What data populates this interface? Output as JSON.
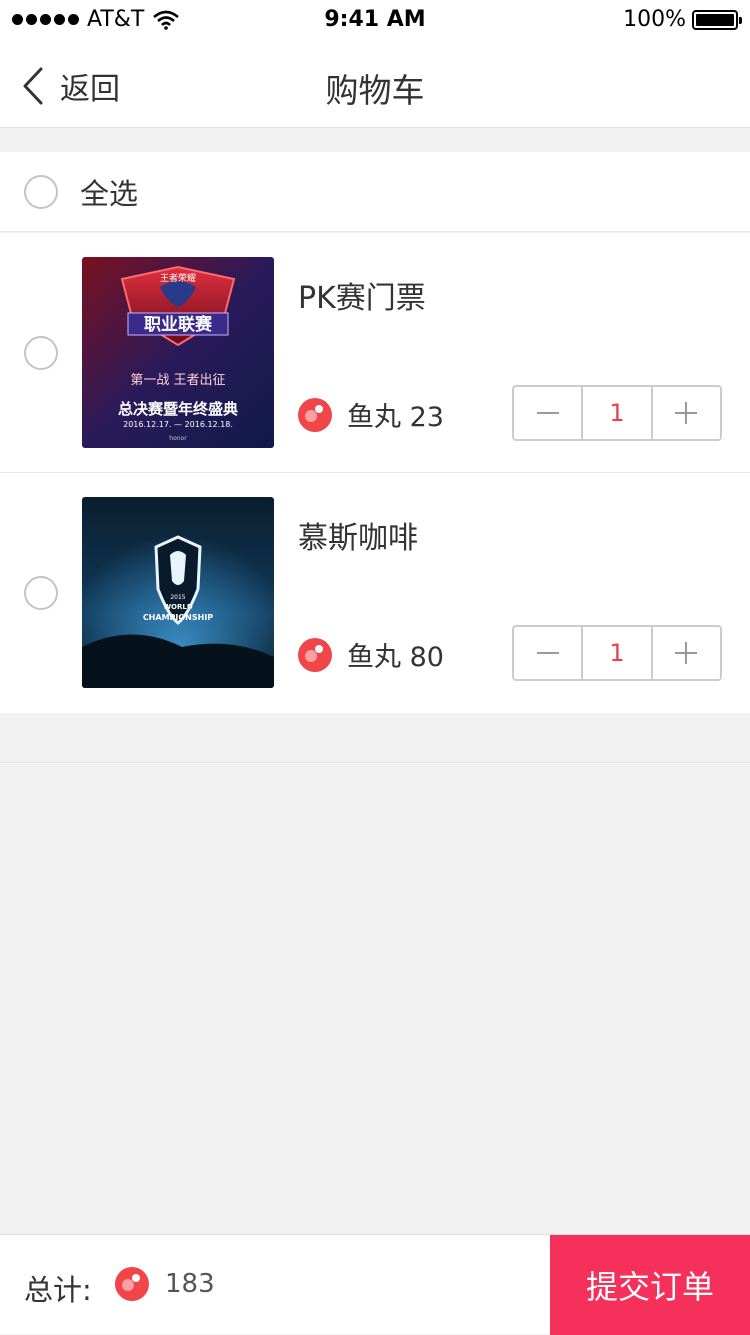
{
  "status_bar": {
    "carrier": "AT&T",
    "time": "9:41 AM",
    "battery": "100%"
  },
  "nav": {
    "back_label": "返回",
    "title": "购物车"
  },
  "select_all": {
    "label": "全选"
  },
  "items": [
    {
      "name": "PK赛门票",
      "price_label": "鱼丸 23",
      "quantity": "1"
    },
    {
      "name": "慕斯咖啡",
      "price_label": "鱼丸 80",
      "quantity": "1"
    }
  ],
  "thumb_texts": {
    "item1_line1": "王者荣耀",
    "item1_line2": "职业联赛",
    "item1_line3": "第一战 王者出征",
    "item1_line4": "总决赛暨年终盛典",
    "item1_line5": "2016.12.17. — 2016.12.18.",
    "item1_line6": "honor",
    "item2_line1": "2015",
    "item2_line2": "WORLD",
    "item2_line3": "CHAMPIONSHIP"
  },
  "footer": {
    "total_label": "总计:",
    "total_value": "183",
    "submit_label": "提交订单"
  },
  "colors": {
    "accent": "#f5305a",
    "coin": "#f0464a",
    "qty": "#f03c4a"
  }
}
